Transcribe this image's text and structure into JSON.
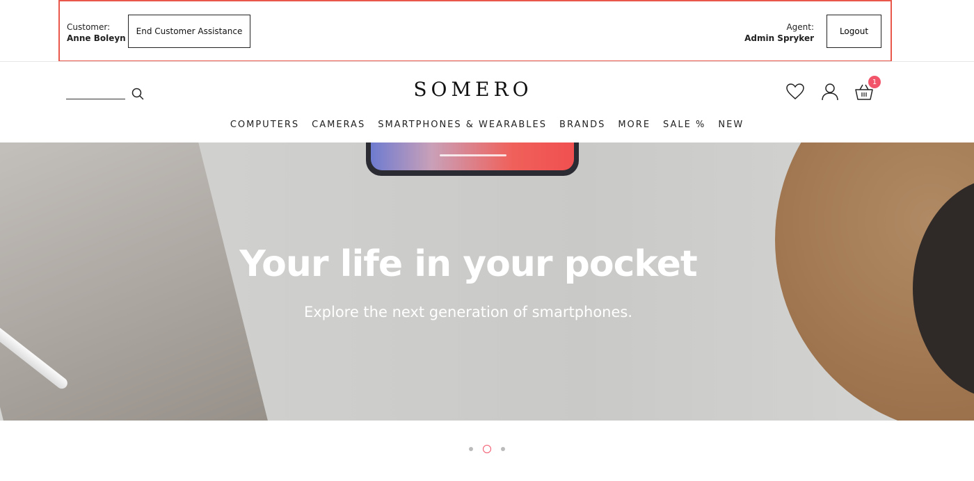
{
  "agent_bar": {
    "customer_label": "Customer:",
    "customer_name": "Anne Boleyn",
    "end_assistance_label": "End Customer Assistance",
    "agent_label": "Agent:",
    "agent_name": "Admin Spryker",
    "logout_label": "Logout"
  },
  "header": {
    "logo": "SOMERO",
    "cart_count": "1"
  },
  "nav": {
    "items": [
      "COMPUTERS",
      "CAMERAS",
      "SMARTPHONES & WEARABLES",
      "BRANDS",
      "MORE",
      "SALE %",
      "NEW"
    ]
  },
  "hero": {
    "title": "Your life in your pocket",
    "subtitle": "Explore the next generation of smartphones."
  },
  "carousel": {
    "slide_count": 3,
    "active_index": 1
  },
  "colors": {
    "accent": "#f2546a",
    "highlight_border": "#e8574a"
  }
}
